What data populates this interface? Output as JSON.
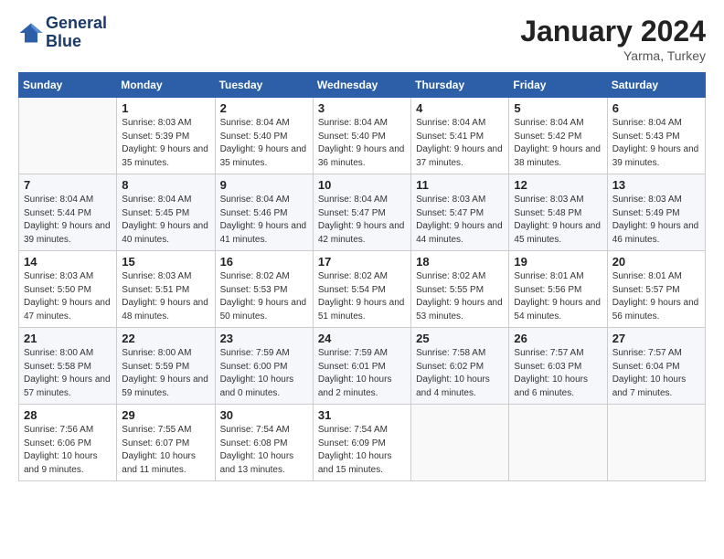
{
  "header": {
    "logo_line1": "General",
    "logo_line2": "Blue",
    "month": "January 2024",
    "location": "Yarma, Turkey"
  },
  "weekdays": [
    "Sunday",
    "Monday",
    "Tuesday",
    "Wednesday",
    "Thursday",
    "Friday",
    "Saturday"
  ],
  "weeks": [
    [
      {
        "day": "",
        "sunrise": "",
        "sunset": "",
        "daylight": ""
      },
      {
        "day": "1",
        "sunrise": "Sunrise: 8:03 AM",
        "sunset": "Sunset: 5:39 PM",
        "daylight": "Daylight: 9 hours and 35 minutes."
      },
      {
        "day": "2",
        "sunrise": "Sunrise: 8:04 AM",
        "sunset": "Sunset: 5:40 PM",
        "daylight": "Daylight: 9 hours and 35 minutes."
      },
      {
        "day": "3",
        "sunrise": "Sunrise: 8:04 AM",
        "sunset": "Sunset: 5:40 PM",
        "daylight": "Daylight: 9 hours and 36 minutes."
      },
      {
        "day": "4",
        "sunrise": "Sunrise: 8:04 AM",
        "sunset": "Sunset: 5:41 PM",
        "daylight": "Daylight: 9 hours and 37 minutes."
      },
      {
        "day": "5",
        "sunrise": "Sunrise: 8:04 AM",
        "sunset": "Sunset: 5:42 PM",
        "daylight": "Daylight: 9 hours and 38 minutes."
      },
      {
        "day": "6",
        "sunrise": "Sunrise: 8:04 AM",
        "sunset": "Sunset: 5:43 PM",
        "daylight": "Daylight: 9 hours and 39 minutes."
      }
    ],
    [
      {
        "day": "7",
        "sunrise": "Sunrise: 8:04 AM",
        "sunset": "Sunset: 5:44 PM",
        "daylight": "Daylight: 9 hours and 39 minutes."
      },
      {
        "day": "8",
        "sunrise": "Sunrise: 8:04 AM",
        "sunset": "Sunset: 5:45 PM",
        "daylight": "Daylight: 9 hours and 40 minutes."
      },
      {
        "day": "9",
        "sunrise": "Sunrise: 8:04 AM",
        "sunset": "Sunset: 5:46 PM",
        "daylight": "Daylight: 9 hours and 41 minutes."
      },
      {
        "day": "10",
        "sunrise": "Sunrise: 8:04 AM",
        "sunset": "Sunset: 5:47 PM",
        "daylight": "Daylight: 9 hours and 42 minutes."
      },
      {
        "day": "11",
        "sunrise": "Sunrise: 8:03 AM",
        "sunset": "Sunset: 5:47 PM",
        "daylight": "Daylight: 9 hours and 44 minutes."
      },
      {
        "day": "12",
        "sunrise": "Sunrise: 8:03 AM",
        "sunset": "Sunset: 5:48 PM",
        "daylight": "Daylight: 9 hours and 45 minutes."
      },
      {
        "day": "13",
        "sunrise": "Sunrise: 8:03 AM",
        "sunset": "Sunset: 5:49 PM",
        "daylight": "Daylight: 9 hours and 46 minutes."
      }
    ],
    [
      {
        "day": "14",
        "sunrise": "Sunrise: 8:03 AM",
        "sunset": "Sunset: 5:50 PM",
        "daylight": "Daylight: 9 hours and 47 minutes."
      },
      {
        "day": "15",
        "sunrise": "Sunrise: 8:03 AM",
        "sunset": "Sunset: 5:51 PM",
        "daylight": "Daylight: 9 hours and 48 minutes."
      },
      {
        "day": "16",
        "sunrise": "Sunrise: 8:02 AM",
        "sunset": "Sunset: 5:53 PM",
        "daylight": "Daylight: 9 hours and 50 minutes."
      },
      {
        "day": "17",
        "sunrise": "Sunrise: 8:02 AM",
        "sunset": "Sunset: 5:54 PM",
        "daylight": "Daylight: 9 hours and 51 minutes."
      },
      {
        "day": "18",
        "sunrise": "Sunrise: 8:02 AM",
        "sunset": "Sunset: 5:55 PM",
        "daylight": "Daylight: 9 hours and 53 minutes."
      },
      {
        "day": "19",
        "sunrise": "Sunrise: 8:01 AM",
        "sunset": "Sunset: 5:56 PM",
        "daylight": "Daylight: 9 hours and 54 minutes."
      },
      {
        "day": "20",
        "sunrise": "Sunrise: 8:01 AM",
        "sunset": "Sunset: 5:57 PM",
        "daylight": "Daylight: 9 hours and 56 minutes."
      }
    ],
    [
      {
        "day": "21",
        "sunrise": "Sunrise: 8:00 AM",
        "sunset": "Sunset: 5:58 PM",
        "daylight": "Daylight: 9 hours and 57 minutes."
      },
      {
        "day": "22",
        "sunrise": "Sunrise: 8:00 AM",
        "sunset": "Sunset: 5:59 PM",
        "daylight": "Daylight: 9 hours and 59 minutes."
      },
      {
        "day": "23",
        "sunrise": "Sunrise: 7:59 AM",
        "sunset": "Sunset: 6:00 PM",
        "daylight": "Daylight: 10 hours and 0 minutes."
      },
      {
        "day": "24",
        "sunrise": "Sunrise: 7:59 AM",
        "sunset": "Sunset: 6:01 PM",
        "daylight": "Daylight: 10 hours and 2 minutes."
      },
      {
        "day": "25",
        "sunrise": "Sunrise: 7:58 AM",
        "sunset": "Sunset: 6:02 PM",
        "daylight": "Daylight: 10 hours and 4 minutes."
      },
      {
        "day": "26",
        "sunrise": "Sunrise: 7:57 AM",
        "sunset": "Sunset: 6:03 PM",
        "daylight": "Daylight: 10 hours and 6 minutes."
      },
      {
        "day": "27",
        "sunrise": "Sunrise: 7:57 AM",
        "sunset": "Sunset: 6:04 PM",
        "daylight": "Daylight: 10 hours and 7 minutes."
      }
    ],
    [
      {
        "day": "28",
        "sunrise": "Sunrise: 7:56 AM",
        "sunset": "Sunset: 6:06 PM",
        "daylight": "Daylight: 10 hours and 9 minutes."
      },
      {
        "day": "29",
        "sunrise": "Sunrise: 7:55 AM",
        "sunset": "Sunset: 6:07 PM",
        "daylight": "Daylight: 10 hours and 11 minutes."
      },
      {
        "day": "30",
        "sunrise": "Sunrise: 7:54 AM",
        "sunset": "Sunset: 6:08 PM",
        "daylight": "Daylight: 10 hours and 13 minutes."
      },
      {
        "day": "31",
        "sunrise": "Sunrise: 7:54 AM",
        "sunset": "Sunset: 6:09 PM",
        "daylight": "Daylight: 10 hours and 15 minutes."
      },
      {
        "day": "",
        "sunrise": "",
        "sunset": "",
        "daylight": ""
      },
      {
        "day": "",
        "sunrise": "",
        "sunset": "",
        "daylight": ""
      },
      {
        "day": "",
        "sunrise": "",
        "sunset": "",
        "daylight": ""
      }
    ]
  ]
}
